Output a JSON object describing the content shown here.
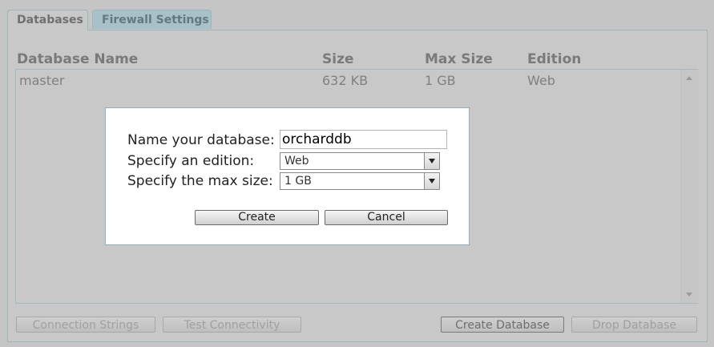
{
  "tabs": [
    {
      "label": "Databases",
      "active": true
    },
    {
      "label": "Firewall Settings",
      "active": false
    }
  ],
  "table": {
    "columns": [
      "Database Name",
      "Size",
      "Max Size",
      "Edition"
    ],
    "rows": [
      {
        "name": "master",
        "size": "632 KB",
        "max_size": "1 GB",
        "edition": "Web"
      }
    ]
  },
  "actions": {
    "connection_strings": "Connection Strings",
    "test_connectivity": "Test Connectivity",
    "create_database": "Create Database",
    "drop_database": "Drop Database"
  },
  "dialog": {
    "name_label": "Name your database:",
    "name_value": "orcharddb",
    "edition_label": "Specify an edition:",
    "edition_value": "Web",
    "max_size_label": "Specify the max size:",
    "max_size_value": "1 GB",
    "create_label": "Create",
    "cancel_label": "Cancel"
  },
  "colors": {
    "overlay": "#c5c5c5",
    "dialog_background": "#ffffff",
    "dialog_border": "#8fb0c8",
    "inactive_tab": "#a8c0c8"
  }
}
